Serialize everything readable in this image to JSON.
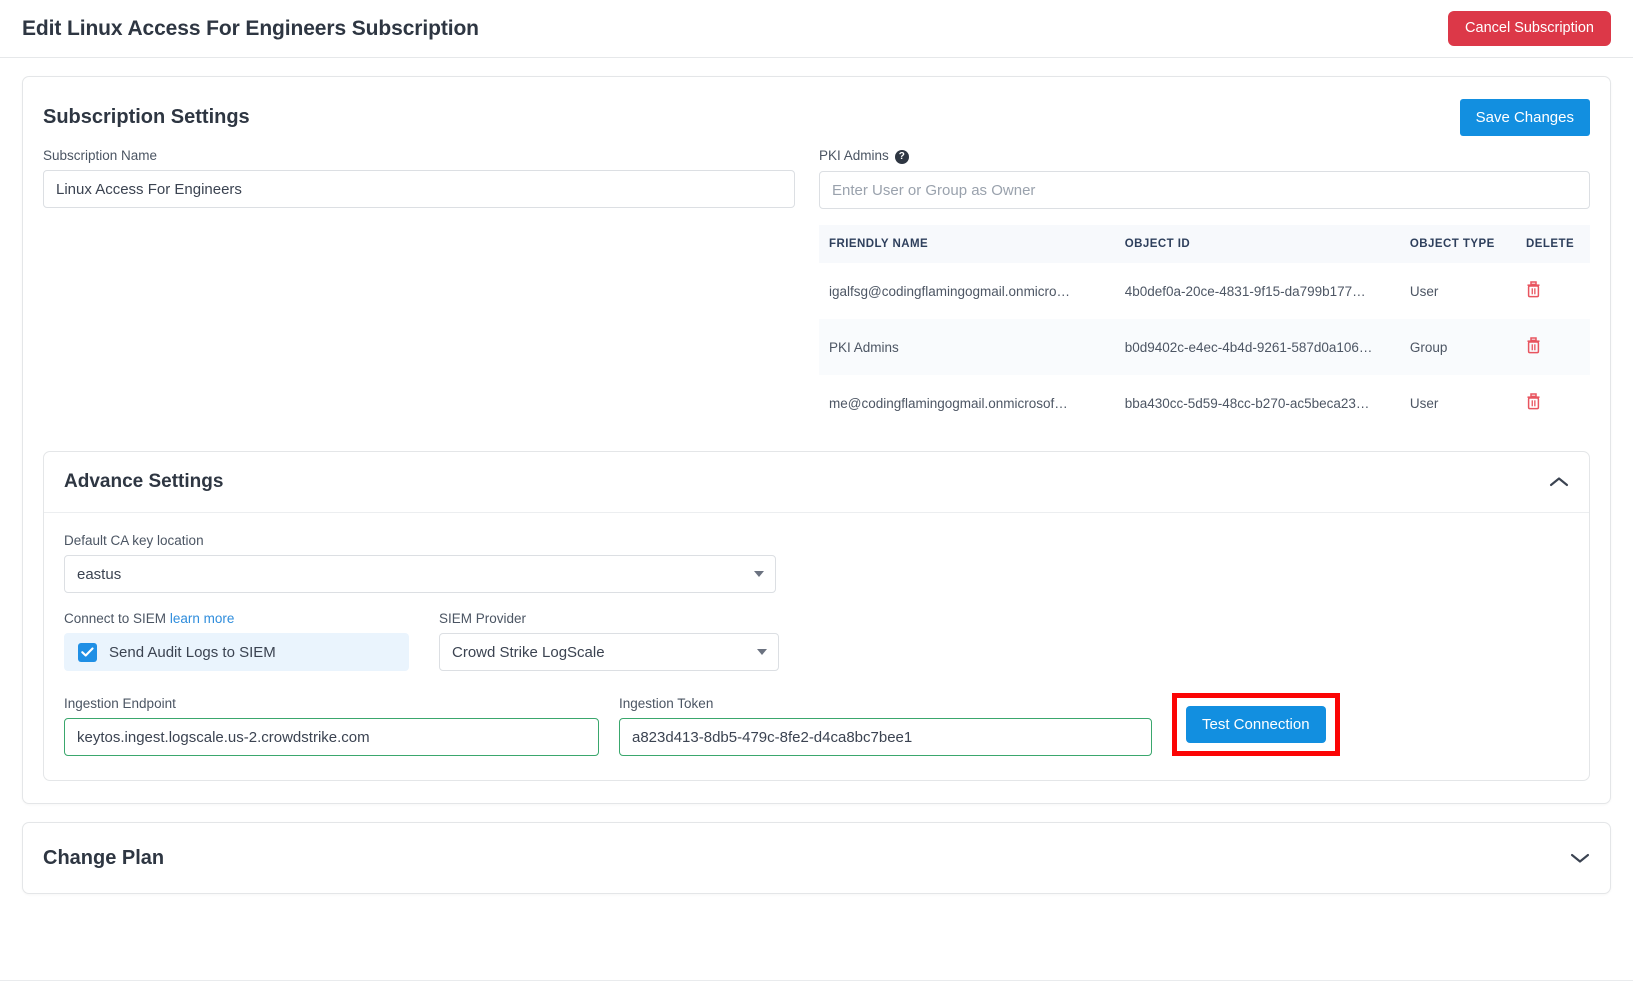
{
  "header": {
    "title": "Edit Linux Access For Engineers Subscription",
    "cancel_button": "Cancel Subscription"
  },
  "subscription_settings": {
    "title": "Subscription Settings",
    "save_button": "Save Changes",
    "subscription_name": {
      "label": "Subscription Name",
      "value": "Linux Access For Engineers"
    },
    "pki_admins": {
      "label": "PKI Admins",
      "help_glyph": "?",
      "input_placeholder": "Enter User or Group as Owner",
      "input_value": "",
      "columns": [
        "FRIENDLY NAME",
        "OBJECT ID",
        "OBJECT TYPE",
        "DELETE"
      ],
      "rows": [
        {
          "friendly_name": "igalfsg@codingflamingogmail.onmicro…",
          "object_id": "4b0def0a-20ce-4831-9f15-da799b177…",
          "object_type": "User"
        },
        {
          "friendly_name": "PKI Admins",
          "object_id": "b0d9402c-e4ec-4b4d-9261-587d0a106…",
          "object_type": "Group"
        },
        {
          "friendly_name": "me@codingflamingogmail.onmicrosof…",
          "object_id": "bba430cc-5d59-48cc-b270-ac5beca23…",
          "object_type": "User"
        }
      ]
    }
  },
  "advance_settings": {
    "title": "Advance Settings",
    "expanded": true,
    "ca_key_location": {
      "label": "Default CA key location",
      "value": "eastus"
    },
    "connect_to_siem": {
      "label": "Connect to SIEM",
      "link_text": "learn more",
      "checkbox_label": "Send Audit Logs to SIEM",
      "checked": true
    },
    "siem_provider": {
      "label": "SIEM Provider",
      "value": "Crowd Strike LogScale"
    },
    "ingestion_endpoint": {
      "label": "Ingestion Endpoint",
      "value": "keytos.ingest.logscale.us-2.crowdstrike.com"
    },
    "ingestion_token": {
      "label": "Ingestion Token",
      "value": "a823d413-8db5-479c-8fe2-d4ca8bc7bee1"
    },
    "test_connection_button": "Test Connection"
  },
  "change_plan": {
    "title": "Change Plan",
    "expanded": false
  },
  "colors": {
    "danger": "#dc3848",
    "primary": "#128fe0",
    "highlight": "#fb0505",
    "valid_border": "#3aa76d",
    "link": "#2f8ddc"
  }
}
